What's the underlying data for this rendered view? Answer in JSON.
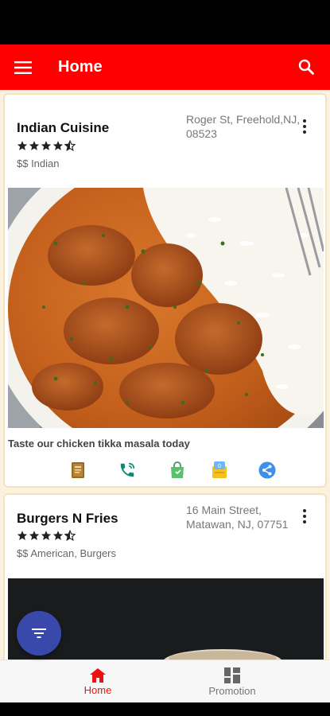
{
  "app_bar": {
    "title": "Home",
    "menu_icon": "hamburger-menu-icon",
    "search_icon": "search-icon",
    "color": "#ff0000"
  },
  "restaurants": [
    {
      "name": "Indian Cuisine",
      "rating": 4.5,
      "category": "$$ Indian",
      "address": "Roger St, Freehold,NJ, 08523",
      "tagline": "Taste our chicken tikka masala today",
      "actions": [
        "menu-book-icon",
        "phone-call-icon",
        "shopping-bag-icon",
        "coupon-icon",
        "share-icon"
      ]
    },
    {
      "name": "Burgers N Fries",
      "rating": 4.5,
      "category": "$$ American, Burgers",
      "address": "16 Main Street, Matawan, NJ, 07751"
    }
  ],
  "fab": {
    "icon": "filter-icon",
    "color": "#3949ab"
  },
  "bottom_nav": [
    {
      "label": "Home",
      "icon": "home-icon",
      "active": true,
      "color": "#ee1111"
    },
    {
      "label": "Promotion",
      "icon": "grid-icon",
      "active": false,
      "color": "#777777"
    }
  ]
}
